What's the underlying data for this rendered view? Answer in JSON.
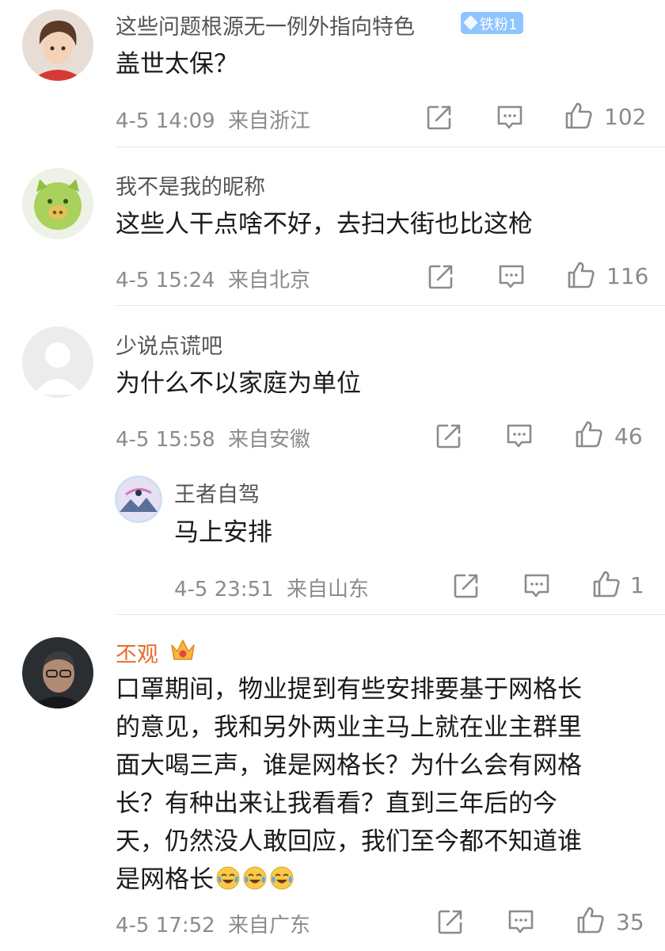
{
  "comments": [
    {
      "username": "这些问题根源无一例外指向特色",
      "badge": "铁粉1",
      "avatar_icon": "anime-boy-avatar",
      "text": "盖世太保？",
      "time": "4-5 14:09",
      "location": "来自浙江",
      "likes": "102"
    },
    {
      "username": "我不是我的昵称",
      "avatar_icon": "green-pig-avatar",
      "text": "这些人干点啥不好，去扫大街也比这枪",
      "time": "4-5 15:24",
      "location": "来自北京",
      "likes": "116"
    },
    {
      "username": "少说点谎吧",
      "avatar_icon": "default-avatar",
      "text": "为什么不以家庭为单位",
      "time": "4-5 15:58",
      "location": "来自安徽",
      "likes": "46"
    },
    {
      "username": "王者自驾",
      "avatar_icon": "landscape-avatar",
      "text": "马上安排",
      "time": "4-5 23:51",
      "location": "来自山东",
      "likes": "1"
    },
    {
      "username": "丕观",
      "vip_icon": "crown-icon",
      "avatar_icon": "man-portrait-avatar",
      "text_lines": [
        "口罩期间，物业提到有些安排要基于网格长",
        "的意见，我和另外两业主马上就在业主群里",
        "面大喝三声，谁是网格长？为什么会有网格",
        "长？有种出来让我看看？直到三年后的今",
        "天，仍然没人敢回应，我们至今都不知道谁",
        "是网格长"
      ],
      "emoji": "😂😂😂",
      "time": "4-5 17:52",
      "location": "来自广东",
      "likes": "35"
    }
  ],
  "icons": {
    "share": "share-icon",
    "comment": "comment-icon",
    "like": "thumbs-up-icon"
  },
  "colors": {
    "vip_name": "#e8692b",
    "badge_bg": "#8fc4ff",
    "meta_text": "#8b8b8b"
  }
}
